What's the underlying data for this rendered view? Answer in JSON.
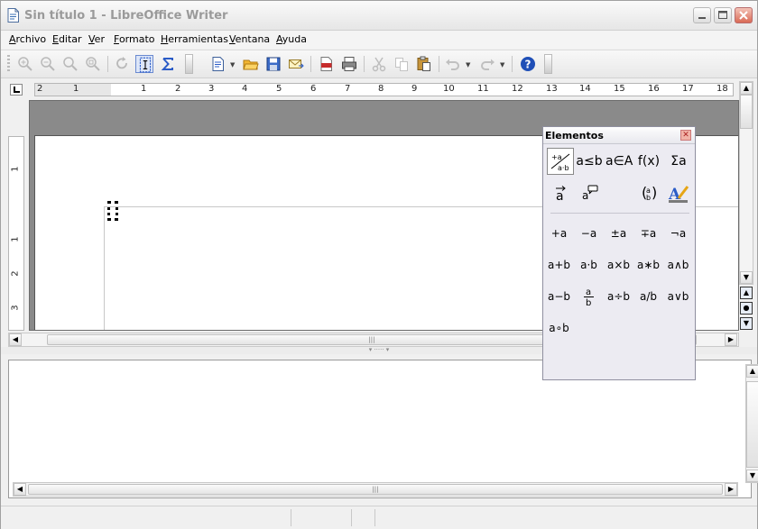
{
  "window": {
    "title": "Sin título 1 - LibreOffice Writer"
  },
  "menubar": {
    "items": [
      "Archivo",
      "Editar",
      "Ver",
      "Formato",
      "Herramientas",
      "Ventana",
      "Ayuda"
    ]
  },
  "toolbar": {
    "buttons": [
      "zoom-in-icon",
      "zoom-out-icon",
      "zoom-100-icon",
      "show-all-icon",
      "update-icon",
      "formula-cursor-icon",
      "symbols-icon",
      "new-document-icon",
      "open-folder-icon",
      "save-icon",
      "email-icon",
      "export-pdf-icon",
      "print-icon",
      "cut-icon",
      "copy-icon",
      "paste-icon",
      "undo-icon",
      "redo-icon",
      "help-icon"
    ]
  },
  "hruler": {
    "ticks": [
      "2",
      "1",
      "1",
      "2",
      "3",
      "4",
      "5",
      "6",
      "7",
      "8",
      "9",
      "10",
      "11",
      "12",
      "13",
      "14",
      "15",
      "16",
      "17",
      "18"
    ]
  },
  "vruler": {
    "ticks": [
      "1",
      "1",
      "2",
      "3"
    ]
  },
  "elements_panel": {
    "title": "Elementos",
    "categories": [
      [
        "+a a·b",
        "a≤b",
        "a∈A",
        "f(x)",
        "Σa"
      ],
      [
        "a⃗",
        "a💬",
        "",
        "(a b)",
        "A✎"
      ]
    ],
    "symbols": [
      [
        "+a",
        "−a",
        "±a",
        "∓a",
        "¬a"
      ],
      [
        "a+b",
        "a·b",
        "a×b",
        "a∗b",
        "a∧b"
      ],
      [
        "a−b",
        "a/b frac",
        "a÷b",
        "a/b",
        "a∨b"
      ],
      [
        "a∘b"
      ]
    ]
  },
  "colors": {
    "accent": "#2b5cc7",
    "workspace": "#8a8a8a"
  }
}
